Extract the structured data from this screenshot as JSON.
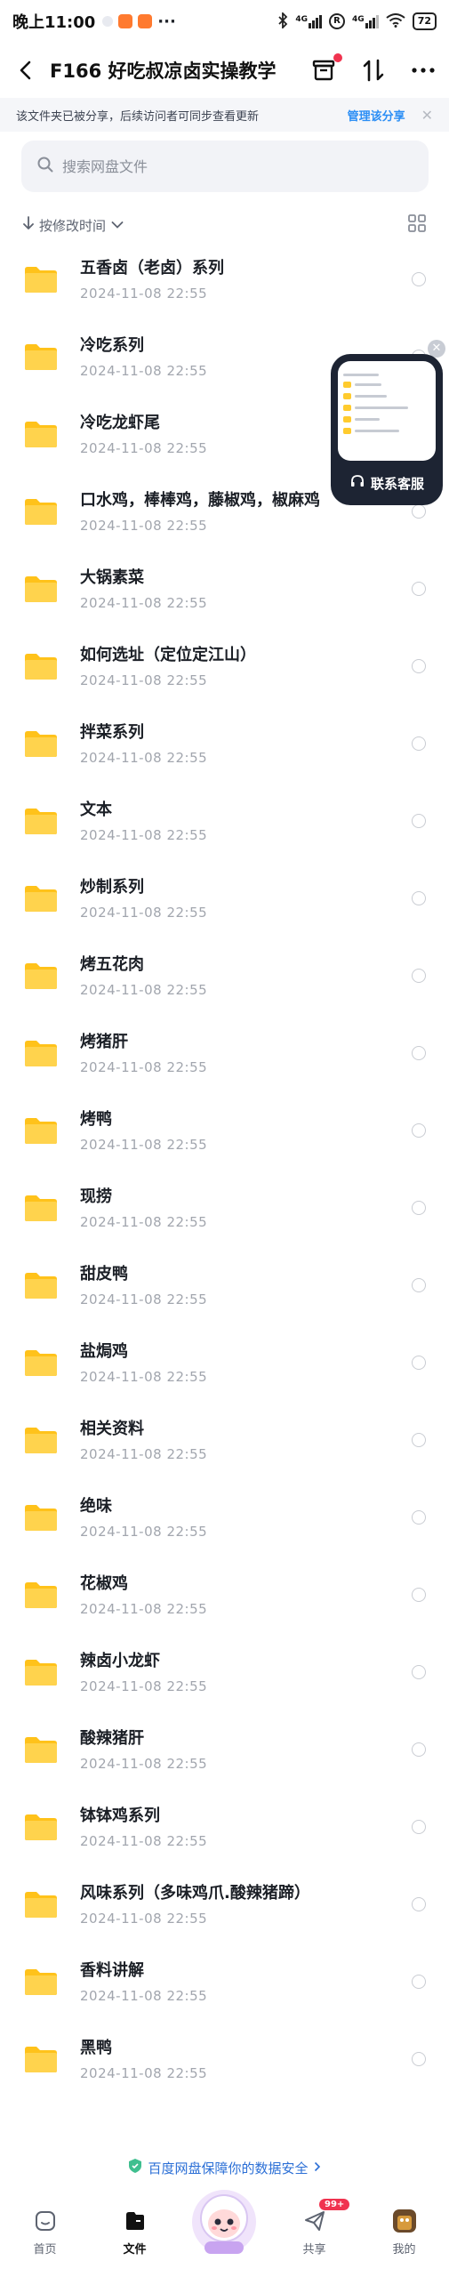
{
  "status_bar": {
    "time": "晚上11:00",
    "battery": "72",
    "signal_1": "4G",
    "signal_2": "4G"
  },
  "title_bar": {
    "title": "F166 好吃叔凉卤实操教学"
  },
  "notice": {
    "text": "该文件夹已被分享，后续访问者可同步查看更新",
    "link": "管理该分享"
  },
  "search": {
    "placeholder": "搜索网盘文件"
  },
  "sort": {
    "label": "按修改时间"
  },
  "files": [
    {
      "name": "五香卤（老卤）系列",
      "date": "2024-11-08  22:55"
    },
    {
      "name": "冷吃系列",
      "date": "2024-11-08  22:55"
    },
    {
      "name": "冷吃龙虾尾",
      "date": "2024-11-08  22:55"
    },
    {
      "name": "口水鸡，棒棒鸡，藤椒鸡，椒麻鸡",
      "date": "2024-11-08  22:55"
    },
    {
      "name": "大锅素菜",
      "date": "2024-11-08  22:55"
    },
    {
      "name": "如何选址（定位定江山）",
      "date": "2024-11-08  22:55"
    },
    {
      "name": "拌菜系列",
      "date": "2024-11-08  22:55"
    },
    {
      "name": "文本",
      "date": "2024-11-08  22:55"
    },
    {
      "name": "炒制系列",
      "date": "2024-11-08  22:55"
    },
    {
      "name": "烤五花肉",
      "date": "2024-11-08  22:55"
    },
    {
      "name": "烤猪肝",
      "date": "2024-11-08  22:55"
    },
    {
      "name": "烤鸭",
      "date": "2024-11-08  22:55"
    },
    {
      "name": "现捞",
      "date": "2024-11-08  22:55"
    },
    {
      "name": "甜皮鸭",
      "date": "2024-11-08  22:55"
    },
    {
      "name": "盐焗鸡",
      "date": "2024-11-08  22:55"
    },
    {
      "name": "相关资料",
      "date": "2024-11-08  22:55"
    },
    {
      "name": "绝味",
      "date": "2024-11-08  22:55"
    },
    {
      "name": "花椒鸡",
      "date": "2024-11-08  22:55"
    },
    {
      "name": "辣卤小龙虾",
      "date": "2024-11-08  22:55"
    },
    {
      "name": "酸辣猪肝",
      "date": "2024-11-08  22:55"
    },
    {
      "name": "钵钵鸡系列",
      "date": "2024-11-08  22:55"
    },
    {
      "name": "风味系列（多味鸡爪.酸辣猪蹄）",
      "date": "2024-11-08  22:55"
    },
    {
      "name": "香料讲解",
      "date": "2024-11-08  22:55"
    },
    {
      "name": "黑鸭",
      "date": "2024-11-08  22:55"
    }
  ],
  "float_widget": {
    "label": "联系客服"
  },
  "footer": {
    "security_text": "百度网盘保障你的数据安全"
  },
  "tabs": [
    {
      "label": "首页"
    },
    {
      "label": "文件"
    },
    {
      "label": ""
    },
    {
      "label": "共享",
      "badge": "99+"
    },
    {
      "label": "我的"
    }
  ],
  "colors": {
    "accent_blue": "#2b8ef5",
    "folder_yellow": "#ffcb2e",
    "badge_red": "#f0334f"
  }
}
